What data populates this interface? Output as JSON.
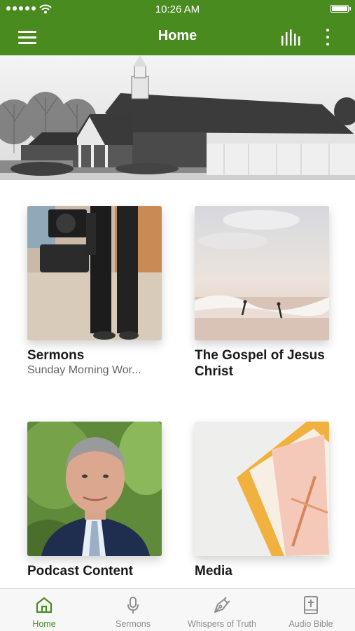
{
  "status": {
    "time": "10:26 AM"
  },
  "header": {
    "title": "Home"
  },
  "cards": [
    {
      "title": "Sermons",
      "subtitle": "Sunday Morning Wor..."
    },
    {
      "title": "The Gospel of Jesus Christ",
      "subtitle": ""
    },
    {
      "title": "Podcast Content",
      "subtitle": ""
    },
    {
      "title": "Media",
      "subtitle": ""
    }
  ],
  "tabs": [
    {
      "label": "Home",
      "icon": "home-icon",
      "active": true
    },
    {
      "label": "Sermons",
      "icon": "microphone-icon",
      "active": false
    },
    {
      "label": "Whispers of Truth",
      "icon": "pen-nib-icon",
      "active": false
    },
    {
      "label": "Audio Bible",
      "icon": "bible-icon",
      "active": false
    }
  ],
  "colors": {
    "brand": "#4a8b1f",
    "tab_inactive": "#8e8e8e"
  }
}
